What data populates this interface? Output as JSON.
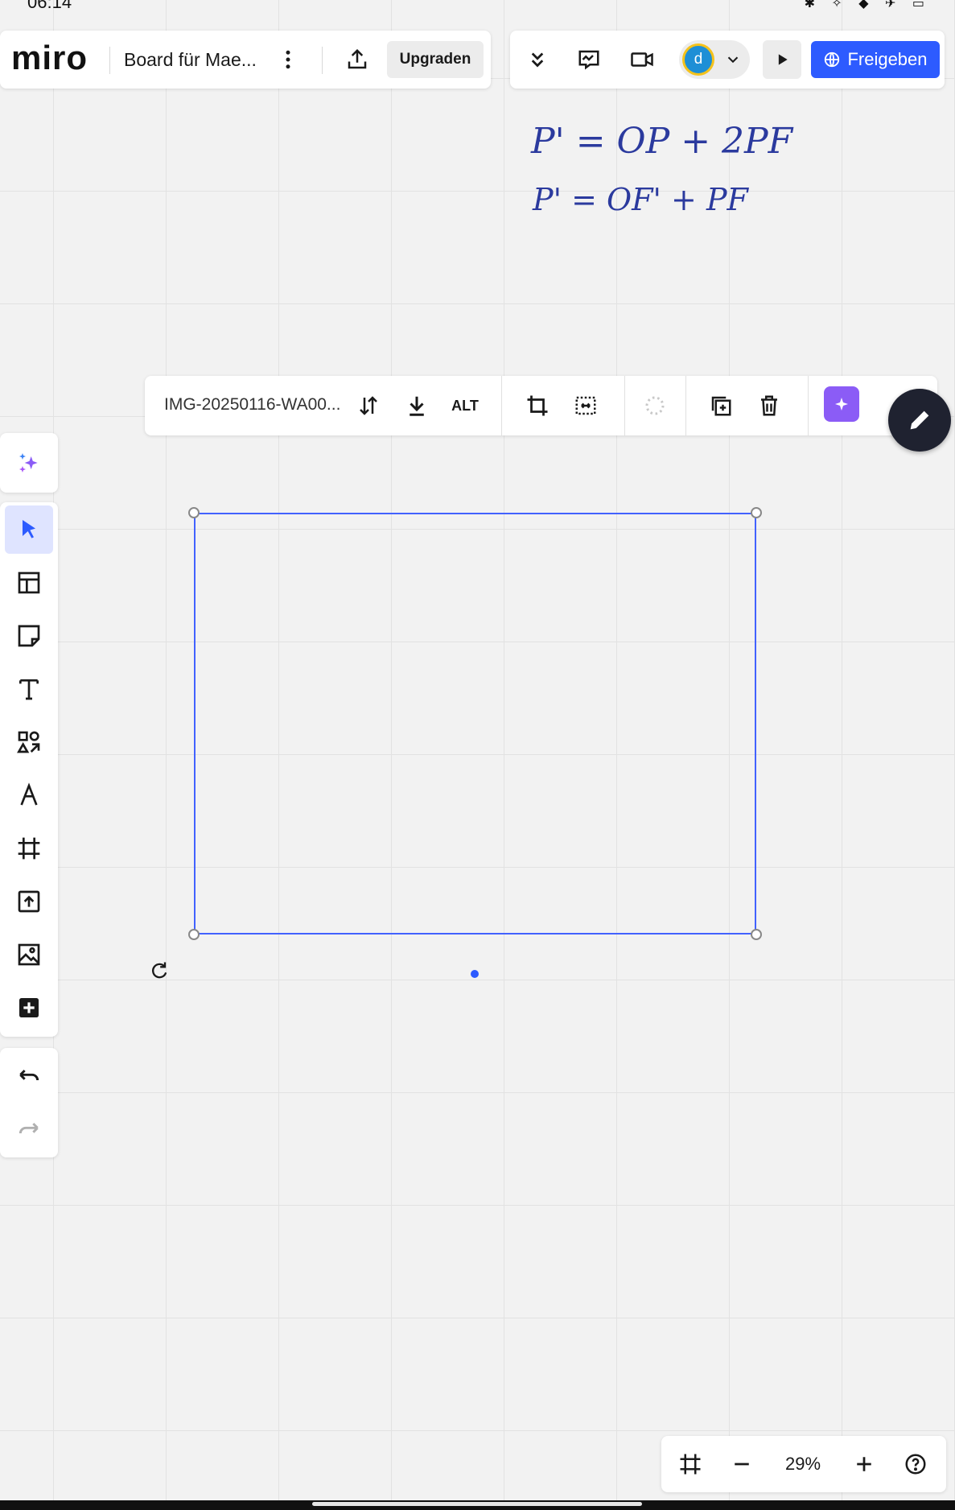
{
  "status_bar": {
    "time": "06:14"
  },
  "header": {
    "logo": "miro",
    "board_title": "Board für Mae...",
    "upgrade_label": "Upgraden",
    "avatar_initial": "d",
    "share_label": "Freigeben"
  },
  "handwriting": {
    "line1": "P' = OP + 2PF",
    "line2": "P' = OF' + PF"
  },
  "context_toolbar": {
    "file_name": "IMG-20250116-WA00...",
    "alt_label": "ALT"
  },
  "zoom": {
    "level": "29%"
  },
  "colors": {
    "accent": "#2d5bff",
    "selection": "#4262ff",
    "avatar_bg": "#1e8fd6",
    "avatar_ring": "#f5c21b",
    "ai_purple": "#8b5cf6",
    "fab": "#1f2230",
    "handwriting": "#2b3a9e"
  },
  "icons": {
    "top": [
      "menu-dots-icon",
      "export-icon",
      "chevrons-down-icon",
      "comment-icon",
      "video-icon",
      "chevron-down-icon",
      "play-icon",
      "globe-icon"
    ],
    "context": [
      "replace-icon",
      "download-icon",
      "crop-icon",
      "fit-icon",
      "loading-icon",
      "duplicate-icon",
      "trash-icon",
      "ai-sparkle-icon",
      "pen-icon"
    ],
    "tools": [
      "ai-sparkle-icon",
      "select-icon",
      "templates-icon",
      "sticky-note-icon",
      "text-icon",
      "shapes-icon",
      "pen-icon",
      "frame-icon",
      "upload-icon",
      "image-icon",
      "more-apps-icon",
      "undo-icon",
      "redo-icon"
    ],
    "bottom": [
      "frames-icon",
      "zoom-out-icon",
      "zoom-in-icon",
      "help-icon"
    ]
  }
}
